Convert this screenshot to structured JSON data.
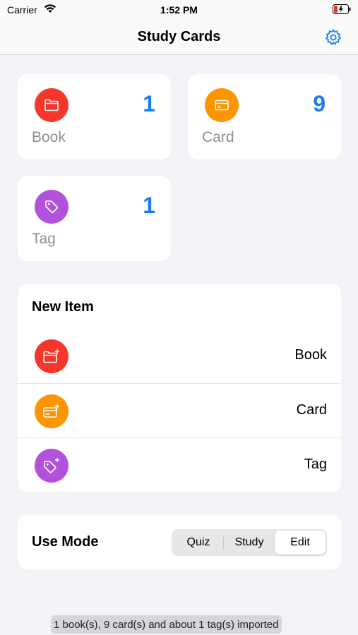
{
  "status_bar": {
    "carrier": "Carrier",
    "time": "1:52 PM"
  },
  "nav": {
    "title": "Study Cards"
  },
  "stats": [
    {
      "label": "Book",
      "count": "1",
      "color": "#f5372b"
    },
    {
      "label": "Card",
      "count": "9",
      "color": "#fd9500"
    },
    {
      "label": "Tag",
      "count": "1",
      "color": "#b151dc"
    }
  ],
  "new_item": {
    "header": "New Item",
    "rows": [
      {
        "label": "Book",
        "color": "#f5372b"
      },
      {
        "label": "Card",
        "color": "#fd9500"
      },
      {
        "label": "Tag",
        "color": "#b151dc"
      }
    ]
  },
  "use_mode": {
    "label": "Use Mode",
    "options": [
      "Quiz",
      "Study",
      "Edit"
    ],
    "selected": "Edit"
  },
  "toast": "1 book(s), 9 card(s) and about 1 tag(s) imported",
  "colors": {
    "accent": "#1a7cf5",
    "background": "#f2f2f7"
  }
}
